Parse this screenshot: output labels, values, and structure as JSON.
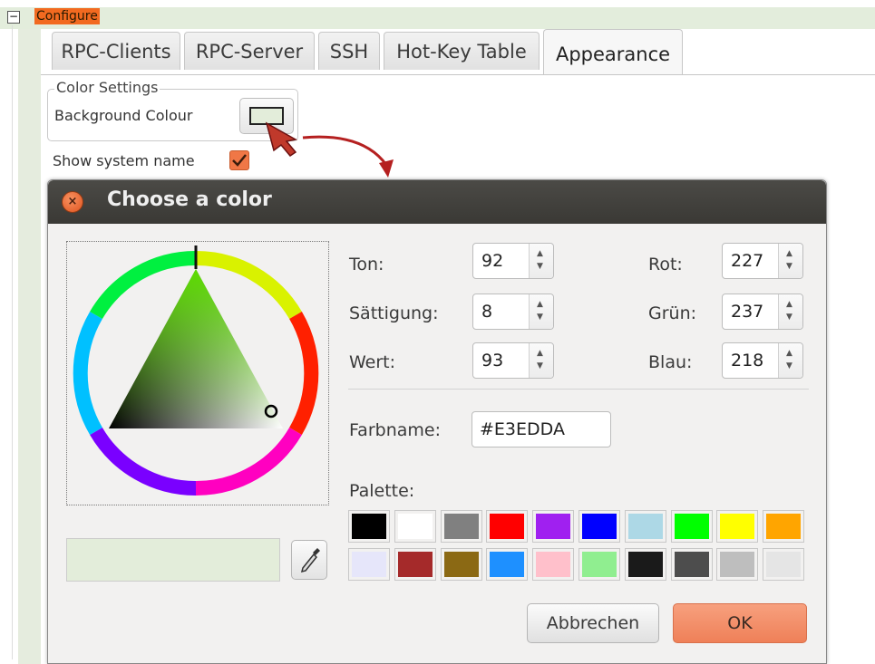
{
  "tree": {
    "toggle_symbol": "−",
    "node_label": "Configure"
  },
  "tabs": [
    {
      "label": "RPC-Clients",
      "active": false
    },
    {
      "label": "RPC-Server",
      "active": false
    },
    {
      "label": "SSH",
      "active": false
    },
    {
      "label": "Hot-Key Table",
      "active": false
    },
    {
      "label": "Appearance",
      "active": true
    }
  ],
  "color_settings": {
    "group_title": "Color Settings",
    "background_label": "Background Colour",
    "swatch_color": "#E3EDDA"
  },
  "show_system_name": {
    "label": "Show system name",
    "checked": true
  },
  "dialog": {
    "title": "Choose a color",
    "close_icon": "close-icon",
    "fields_left": [
      {
        "label": "Ton:",
        "value": "92"
      },
      {
        "label": "Sättigung:",
        "value": "8"
      },
      {
        "label": "Wert:",
        "value": "93"
      }
    ],
    "fields_right": [
      {
        "label": "Rot:",
        "value": "227"
      },
      {
        "label": "Grün:",
        "value": "237"
      },
      {
        "label": "Blau:",
        "value": "218"
      }
    ],
    "colorname_label": "Farbname:",
    "colorname_value": "#E3EDDA",
    "palette_label": "Palette:",
    "palette": [
      [
        "#000000",
        "#ffffff",
        "#808080",
        "#ff0000",
        "#a020f0",
        "#0000ff",
        "#add8e6",
        "#00ff00",
        "#ffff00",
        "#ffa500"
      ],
      [
        "#e6e6fa",
        "#a52a2a",
        "#8b6914",
        "#1e90ff",
        "#ffc0cb",
        "#90ee90",
        "#1a1a1a",
        "#4d4d4d",
        "#bebebe",
        "#e5e5e5"
      ]
    ],
    "preview_color": "#E3EDDA",
    "cancel_label": "Abbrechen",
    "ok_label": "OK"
  },
  "colors": {
    "accent_orange": "#f26a20",
    "annotation_red": "#b52020"
  }
}
